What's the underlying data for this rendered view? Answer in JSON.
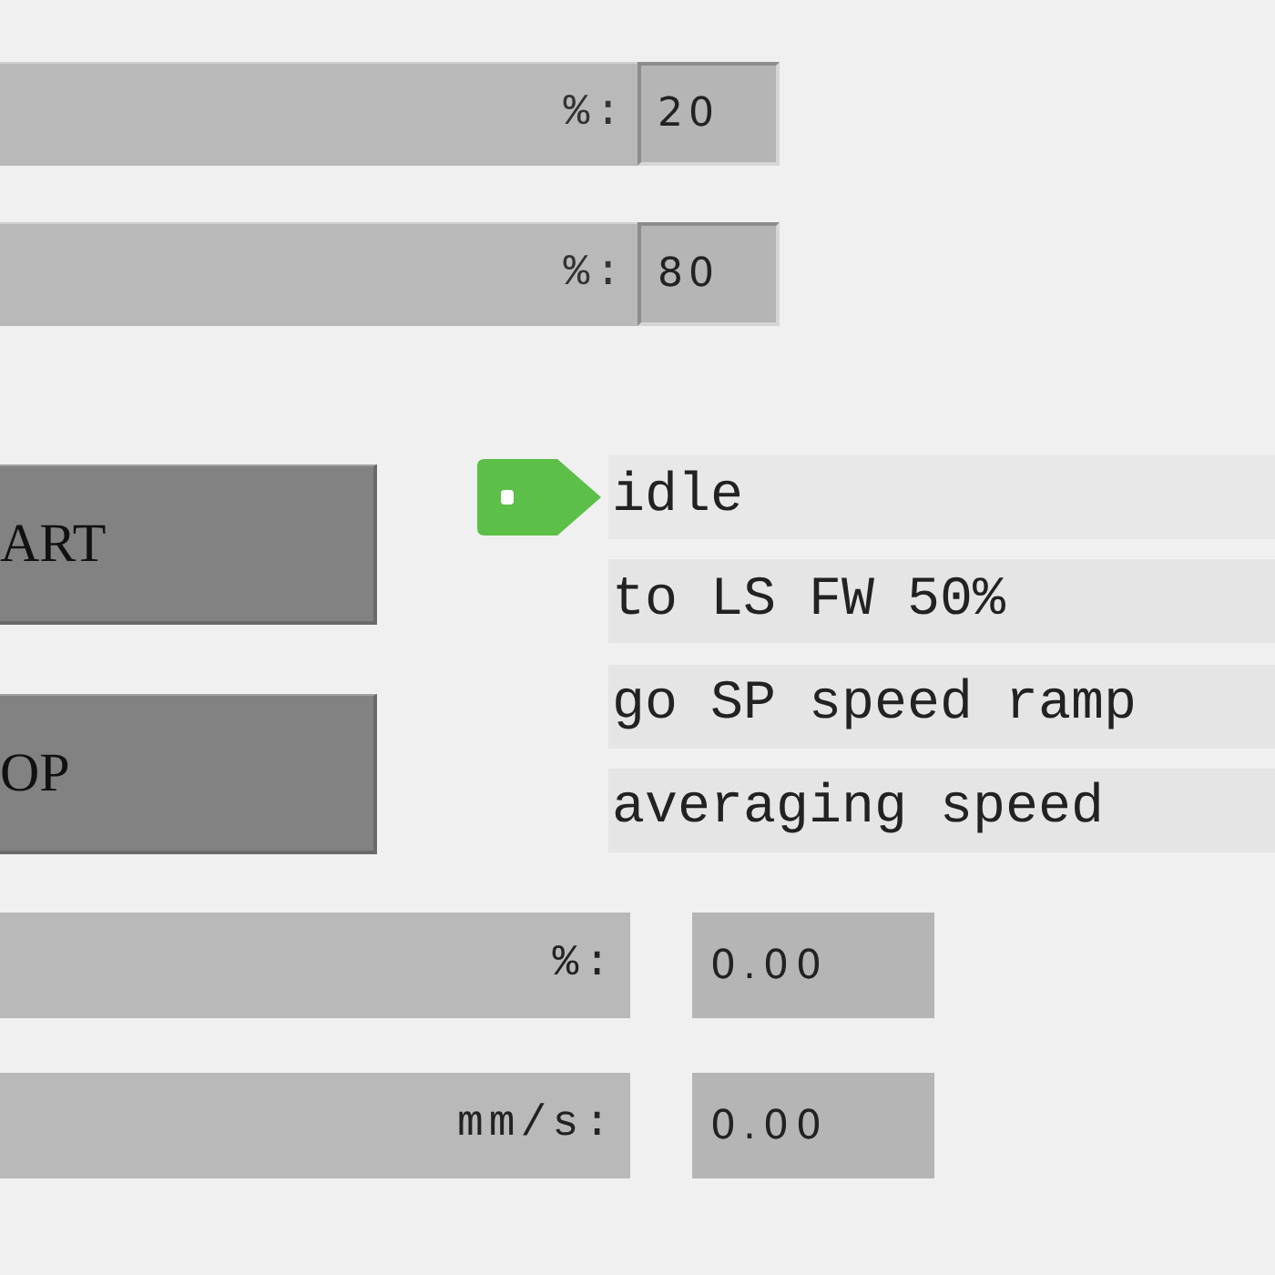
{
  "setpoints": [
    {
      "unit": "%:",
      "value": "20"
    },
    {
      "unit": "%:",
      "value": "80"
    }
  ],
  "buttons": [
    {
      "label": "ART"
    },
    {
      "label": "OP"
    }
  ],
  "steps": [
    {
      "label": "idle",
      "active": true
    },
    {
      "label": "to LS FW 50%",
      "active": false
    },
    {
      "label": "go SP speed ramp",
      "active": false
    },
    {
      "label": "averaging speed",
      "active": false
    }
  ],
  "readouts": [
    {
      "unit": "%:",
      "value": "0.00"
    },
    {
      "unit": "mm/s:",
      "value": "0.00"
    }
  ]
}
